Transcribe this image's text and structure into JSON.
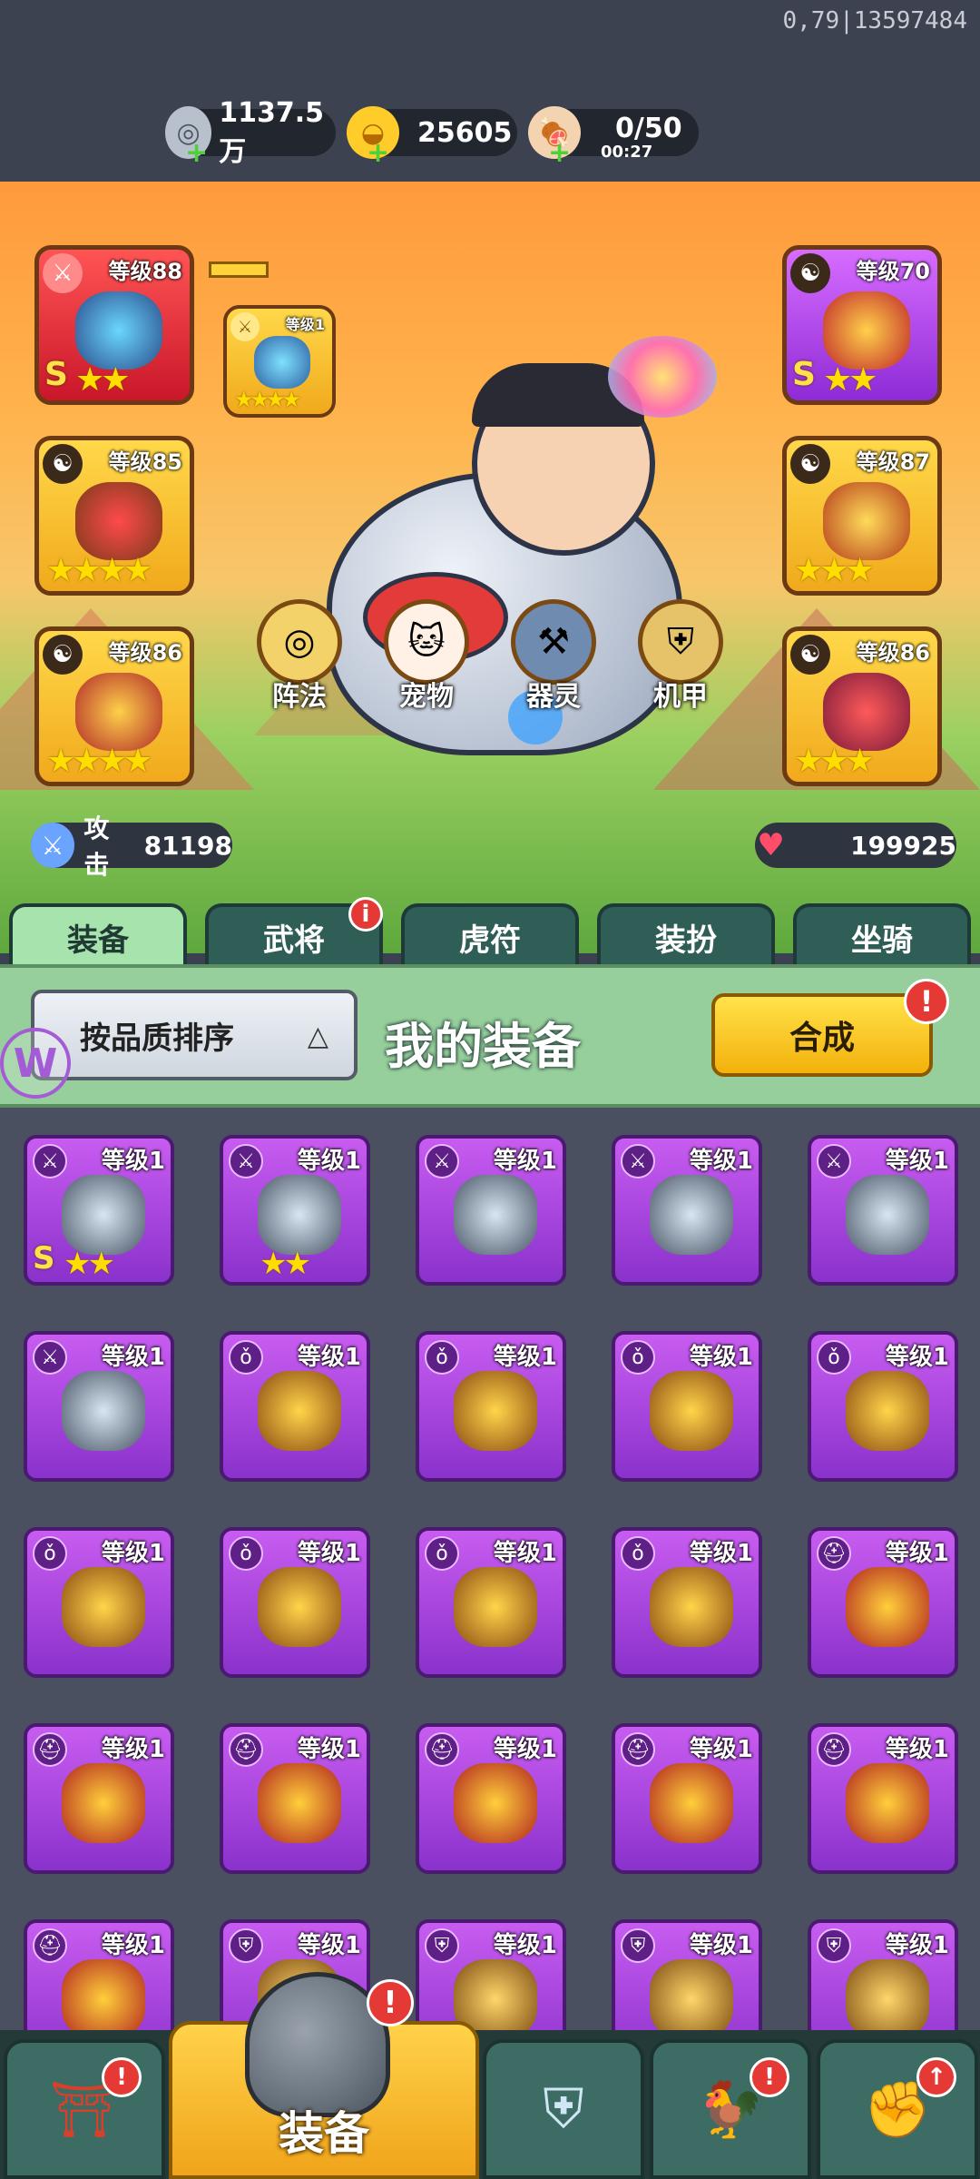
{
  "debug_label": "0,79|13597484",
  "resources": [
    {
      "name": "silver",
      "value": "1137.5万",
      "icon": "silver-coin-icon",
      "plus": "+"
    },
    {
      "name": "gold",
      "value": "25605",
      "icon": "gold-ingot-icon",
      "plus": "+"
    },
    {
      "name": "stamina",
      "value": "0/50",
      "timer": "00:27",
      "icon": "meat-icon",
      "plus": "+"
    }
  ],
  "hero": {
    "slots_left": [
      {
        "level": "等级88",
        "grade": "S",
        "stars": "★★",
        "category": "weapon-icon",
        "color": "red"
      },
      {
        "level": "等级85",
        "grade": "",
        "stars": "★★★★",
        "category": "yinyang-icon",
        "color": "gold"
      },
      {
        "level": "等级86",
        "grade": "",
        "stars": "★★★★",
        "category": "yinyang-icon",
        "color": "gold"
      }
    ],
    "slots_right": [
      {
        "level": "等级70",
        "grade": "S",
        "stars": "★★",
        "category": "yinyang-icon",
        "color": "purple"
      },
      {
        "level": "等级87",
        "grade": "",
        "stars": "★★★",
        "category": "yinyang-icon",
        "color": "gold"
      },
      {
        "level": "等级86",
        "grade": "",
        "stars": "★★★",
        "category": "yinyang-icon",
        "color": "gold"
      }
    ],
    "linked_slot": {
      "level": "等级1",
      "stars": "★★★★"
    },
    "attack": {
      "label": "攻击",
      "value": "81198"
    },
    "hp": {
      "value": "199925"
    },
    "features": [
      {
        "label": "阵法",
        "icon": "formation-icon"
      },
      {
        "label": "宠物",
        "icon": "pet-icon"
      },
      {
        "label": "器灵",
        "icon": "spirit-icon"
      },
      {
        "label": "机甲",
        "icon": "mecha-icon"
      }
    ]
  },
  "tabs": [
    {
      "label": "装备",
      "active": true,
      "badge": ""
    },
    {
      "label": "武将",
      "active": false,
      "badge": "i"
    },
    {
      "label": "虎符",
      "active": false,
      "badge": ""
    },
    {
      "label": "装扮",
      "active": false,
      "badge": ""
    },
    {
      "label": "坐骑",
      "active": false,
      "badge": ""
    }
  ],
  "panel": {
    "sort_label": "按品质排序",
    "title": "我的装备",
    "craft_label": "合成",
    "craft_badge": "!",
    "logo": "W"
  },
  "inventory": [
    {
      "level": "等级1",
      "category": "weapon",
      "grade": "S",
      "stars": "★★"
    },
    {
      "level": "等级1",
      "category": "weapon",
      "grade": "",
      "stars": "★★"
    },
    {
      "level": "等级1",
      "category": "weapon",
      "grade": "",
      "stars": ""
    },
    {
      "level": "等级1",
      "category": "weapon",
      "grade": "",
      "stars": ""
    },
    {
      "level": "等级1",
      "category": "weapon",
      "grade": "",
      "stars": ""
    },
    {
      "level": "等级1",
      "category": "weapon",
      "grade": "",
      "stars": ""
    },
    {
      "level": "等级1",
      "category": "amulet",
      "grade": "",
      "stars": ""
    },
    {
      "level": "等级1",
      "category": "amulet",
      "grade": "",
      "stars": ""
    },
    {
      "level": "等级1",
      "category": "amulet",
      "grade": "",
      "stars": ""
    },
    {
      "level": "等级1",
      "category": "amulet",
      "grade": "",
      "stars": ""
    },
    {
      "level": "等级1",
      "category": "amulet",
      "grade": "",
      "stars": ""
    },
    {
      "level": "等级1",
      "category": "amulet",
      "grade": "",
      "stars": ""
    },
    {
      "level": "等级1",
      "category": "amulet",
      "grade": "",
      "stars": ""
    },
    {
      "level": "等级1",
      "category": "amulet",
      "grade": "",
      "stars": ""
    },
    {
      "level": "等级1",
      "category": "helmet",
      "grade": "",
      "stars": ""
    },
    {
      "level": "等级1",
      "category": "helmet",
      "grade": "",
      "stars": ""
    },
    {
      "level": "等级1",
      "category": "helmet",
      "grade": "",
      "stars": ""
    },
    {
      "level": "等级1",
      "category": "helmet",
      "grade": "",
      "stars": ""
    },
    {
      "level": "等级1",
      "category": "helmet",
      "grade": "",
      "stars": ""
    },
    {
      "level": "等级1",
      "category": "helmet",
      "grade": "",
      "stars": ""
    },
    {
      "level": "等级1",
      "category": "helmet",
      "grade": "",
      "stars": ""
    },
    {
      "level": "等级1",
      "category": "armor",
      "grade": "",
      "stars": ""
    },
    {
      "level": "等级1",
      "category": "armor",
      "grade": "",
      "stars": ""
    },
    {
      "level": "等级1",
      "category": "armor",
      "grade": "",
      "stars": ""
    },
    {
      "level": "等级1",
      "category": "armor",
      "grade": "",
      "stars": ""
    }
  ],
  "nav": [
    {
      "label": "",
      "icon": "gate-icon",
      "badge": "!"
    },
    {
      "label": "装备",
      "icon": "helmet-icon",
      "badge": "!",
      "active": true
    },
    {
      "label": "",
      "icon": "shield-icon",
      "badge": ""
    },
    {
      "label": "",
      "icon": "rooster-icon",
      "badge": "!"
    },
    {
      "label": "",
      "icon": "fist-upgrade-icon",
      "badge": "↑"
    }
  ]
}
